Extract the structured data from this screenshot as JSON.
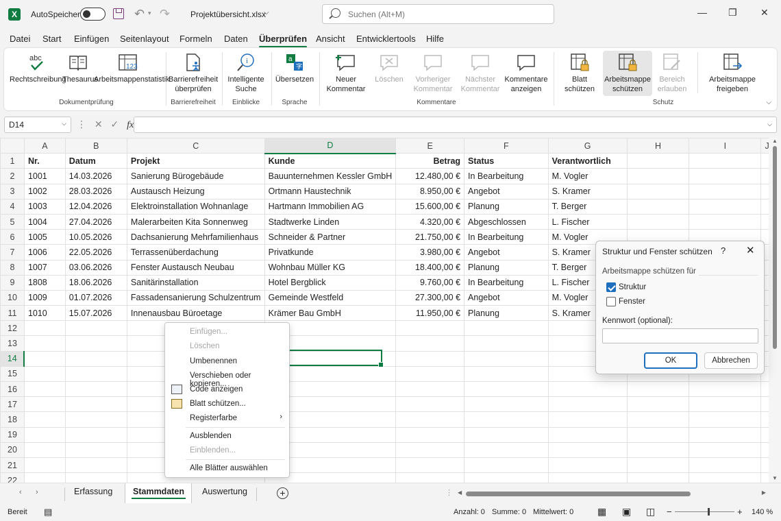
{
  "titlebar": {
    "app_icon": "excel-icon",
    "app_letter": "X",
    "autosave_label": "AutoSpeichern",
    "filename": "Projektübersicht.xlsx",
    "search_placeholder": "Suchen (Alt+M)",
    "minimize": "—",
    "restore": "❐",
    "close": "✕"
  },
  "menu_tabs": [
    "Datei",
    "Start",
    "Einfügen",
    "Seitenlayout",
    "Formeln",
    "Daten",
    "Überprüfen",
    "Ansicht",
    "Entwicklertools",
    "Hilfe"
  ],
  "active_tab": "Überprüfen",
  "ribbon": {
    "groups": {
      "dokumentpruefung": "Dokumentprüfung",
      "barrierefreiheit": "Barrierefreiheit",
      "einblicke": "Einblicke",
      "sprache": "Sprache",
      "kommentare": "Kommentare",
      "schutz": "Schutz"
    },
    "buttons": {
      "rechtschreibung": "Rechtschreibung",
      "thesaurus": "Thesaurus",
      "arbeitsmappenstatistik": "Arbeitsmappenstatistik",
      "barrierefreiheit_1": "Barrierefreiheit",
      "barrierefreiheit_2": "überprüfen",
      "intelligente_1": "Intelligente",
      "intelligente_2": "Suche",
      "uebersetzen": "Übersetzen",
      "neuer_1": "Neuer",
      "neuer_2": "Kommentar",
      "loeschen": "Löschen",
      "vorheriger_1": "Vorheriger",
      "vorheriger_2": "Kommentar",
      "naechster_1": "Nächster",
      "naechster_2": "Kommentar",
      "kommentare_anz_1": "Kommentare",
      "kommentare_anz_2": "anzeigen",
      "blatt_1": "Blatt",
      "blatt_2": "schützen",
      "mappe_1": "Arbeitsmappe",
      "mappe_2": "schützen",
      "bereich_1": "Bereich",
      "bereich_2": "erlauben",
      "freigeben_1": "Arbeitsmappe",
      "freigeben_2": "freigeben",
      "abc": "abc"
    }
  },
  "formula_bar": {
    "name_box": "D14",
    "formula": ""
  },
  "sheet": {
    "columns": [
      "A",
      "B",
      "C",
      "D",
      "E",
      "F",
      "G",
      "H",
      "I",
      "J"
    ],
    "selected_column": "D",
    "selected_row": 14,
    "header": [
      "Nr.",
      "Datum",
      "Projekt",
      "Kunde",
      "Betrag",
      "Status",
      "Verantwortlich"
    ],
    "rows": [
      [
        "1001",
        "14.03.2026",
        "Sanierung Bürogebäude",
        "Bauunternehmen Kessler GmbH",
        "12.480,00 €",
        "In Bearbeitung",
        "M. Vogler"
      ],
      [
        "1002",
        "28.03.2026",
        "Austausch Heizung",
        "Ortmann Haustechnik",
        "8.950,00 €",
        "Angebot",
        "S. Kramer"
      ],
      [
        "1003",
        "12.04.2026",
        "Elektroinstallation Wohnanlage",
        "Hartmann Immobilien AG",
        "15.600,00 €",
        "Planung",
        "T. Berger"
      ],
      [
        "1004",
        "27.04.2026",
        "Malerarbeiten Kita Sonnenweg",
        "Stadtwerke Linden",
        "4.320,00 €",
        "Abgeschlossen",
        "L. Fischer"
      ],
      [
        "1005",
        "10.05.2026",
        "Dachsanierung Mehrfamilienhaus",
        "Schneider & Partner",
        "21.750,00 €",
        "In Bearbeitung",
        "M. Vogler"
      ],
      [
        "1006",
        "22.05.2026",
        "Terrassenüberdachung",
        "Privatkunde",
        "3.980,00 €",
        "Angebot",
        "S. Kramer"
      ],
      [
        "1007",
        "03.06.2026",
        "Fenster Austausch Neubau",
        "Wohnbau Müller KG",
        "18.400,00 €",
        "Planung",
        "T. Berger"
      ],
      [
        "1808",
        "18.06.2026",
        "Sanitärinstallation",
        "Hotel Bergblick",
        "9.760,00 €",
        "In Bearbeitung",
        "L. Fischer"
      ],
      [
        "1009",
        "01.07.2026",
        "Fassadensanierung Schulzentrum",
        "Gemeinde Westfeld",
        "27.300,00 €",
        "Angebot",
        "M. Vogler"
      ],
      [
        "1010",
        "15.07.2026",
        "Innenausbau Büroetage",
        "Krämer Bau GmbH",
        "11.950,00 €",
        "Planung",
        "S. Kramer"
      ]
    ],
    "row_numbers": [
      "1",
      "2",
      "3",
      "4",
      "5",
      "6",
      "7",
      "8",
      "9",
      "10",
      "11",
      "12",
      "13",
      "14",
      "15",
      "16",
      "17",
      "18",
      "19",
      "20",
      "21",
      "22"
    ]
  },
  "context_menu": {
    "items": [
      {
        "label": "Einfügen...",
        "disabled": true
      },
      {
        "label": "Löschen",
        "disabled": true
      },
      {
        "label": "Umbenennen",
        "disabled": false
      },
      {
        "label": "Verschieben oder kopieren...",
        "disabled": false
      },
      {
        "label": "Code anzeigen",
        "disabled": false,
        "icon": "code-view-icon"
      },
      {
        "label": "Blatt schützen...",
        "disabled": false,
        "icon": "protect-sheet-icon"
      },
      {
        "label": "Registerfarbe",
        "disabled": false,
        "submenu": true
      },
      {
        "label": "Ausblenden",
        "disabled": false
      },
      {
        "label": "Einblenden...",
        "disabled": true
      },
      {
        "label": "Alle Blätter auswählen",
        "disabled": false
      }
    ]
  },
  "dialog": {
    "title": "Struktur und Fenster schützen",
    "help": "?",
    "close": "✕",
    "section": "Arbeitsmappe schützen für",
    "struktur_label": "Struktur",
    "struktur_checked": true,
    "fenster_label": "Fenster",
    "fenster_checked": false,
    "password_label": "Kennwort (optional):",
    "password_value": "",
    "ok": "OK",
    "cancel": "Abbrechen"
  },
  "sheet_tabs": [
    "Erfassung",
    "Stammdaten",
    "Auswertung"
  ],
  "active_sheet": "Stammdaten",
  "statusbar": {
    "ready": "Bereit",
    "anzahl": "Anzahl: 0",
    "summe": "Summe: 0",
    "mittelwert": "Mittelwert: 0",
    "zoom": "140 %",
    "minus": "−",
    "plus": "+"
  },
  "colors": {
    "accent": "#107c41",
    "checkbox": "#1f6fbf"
  }
}
